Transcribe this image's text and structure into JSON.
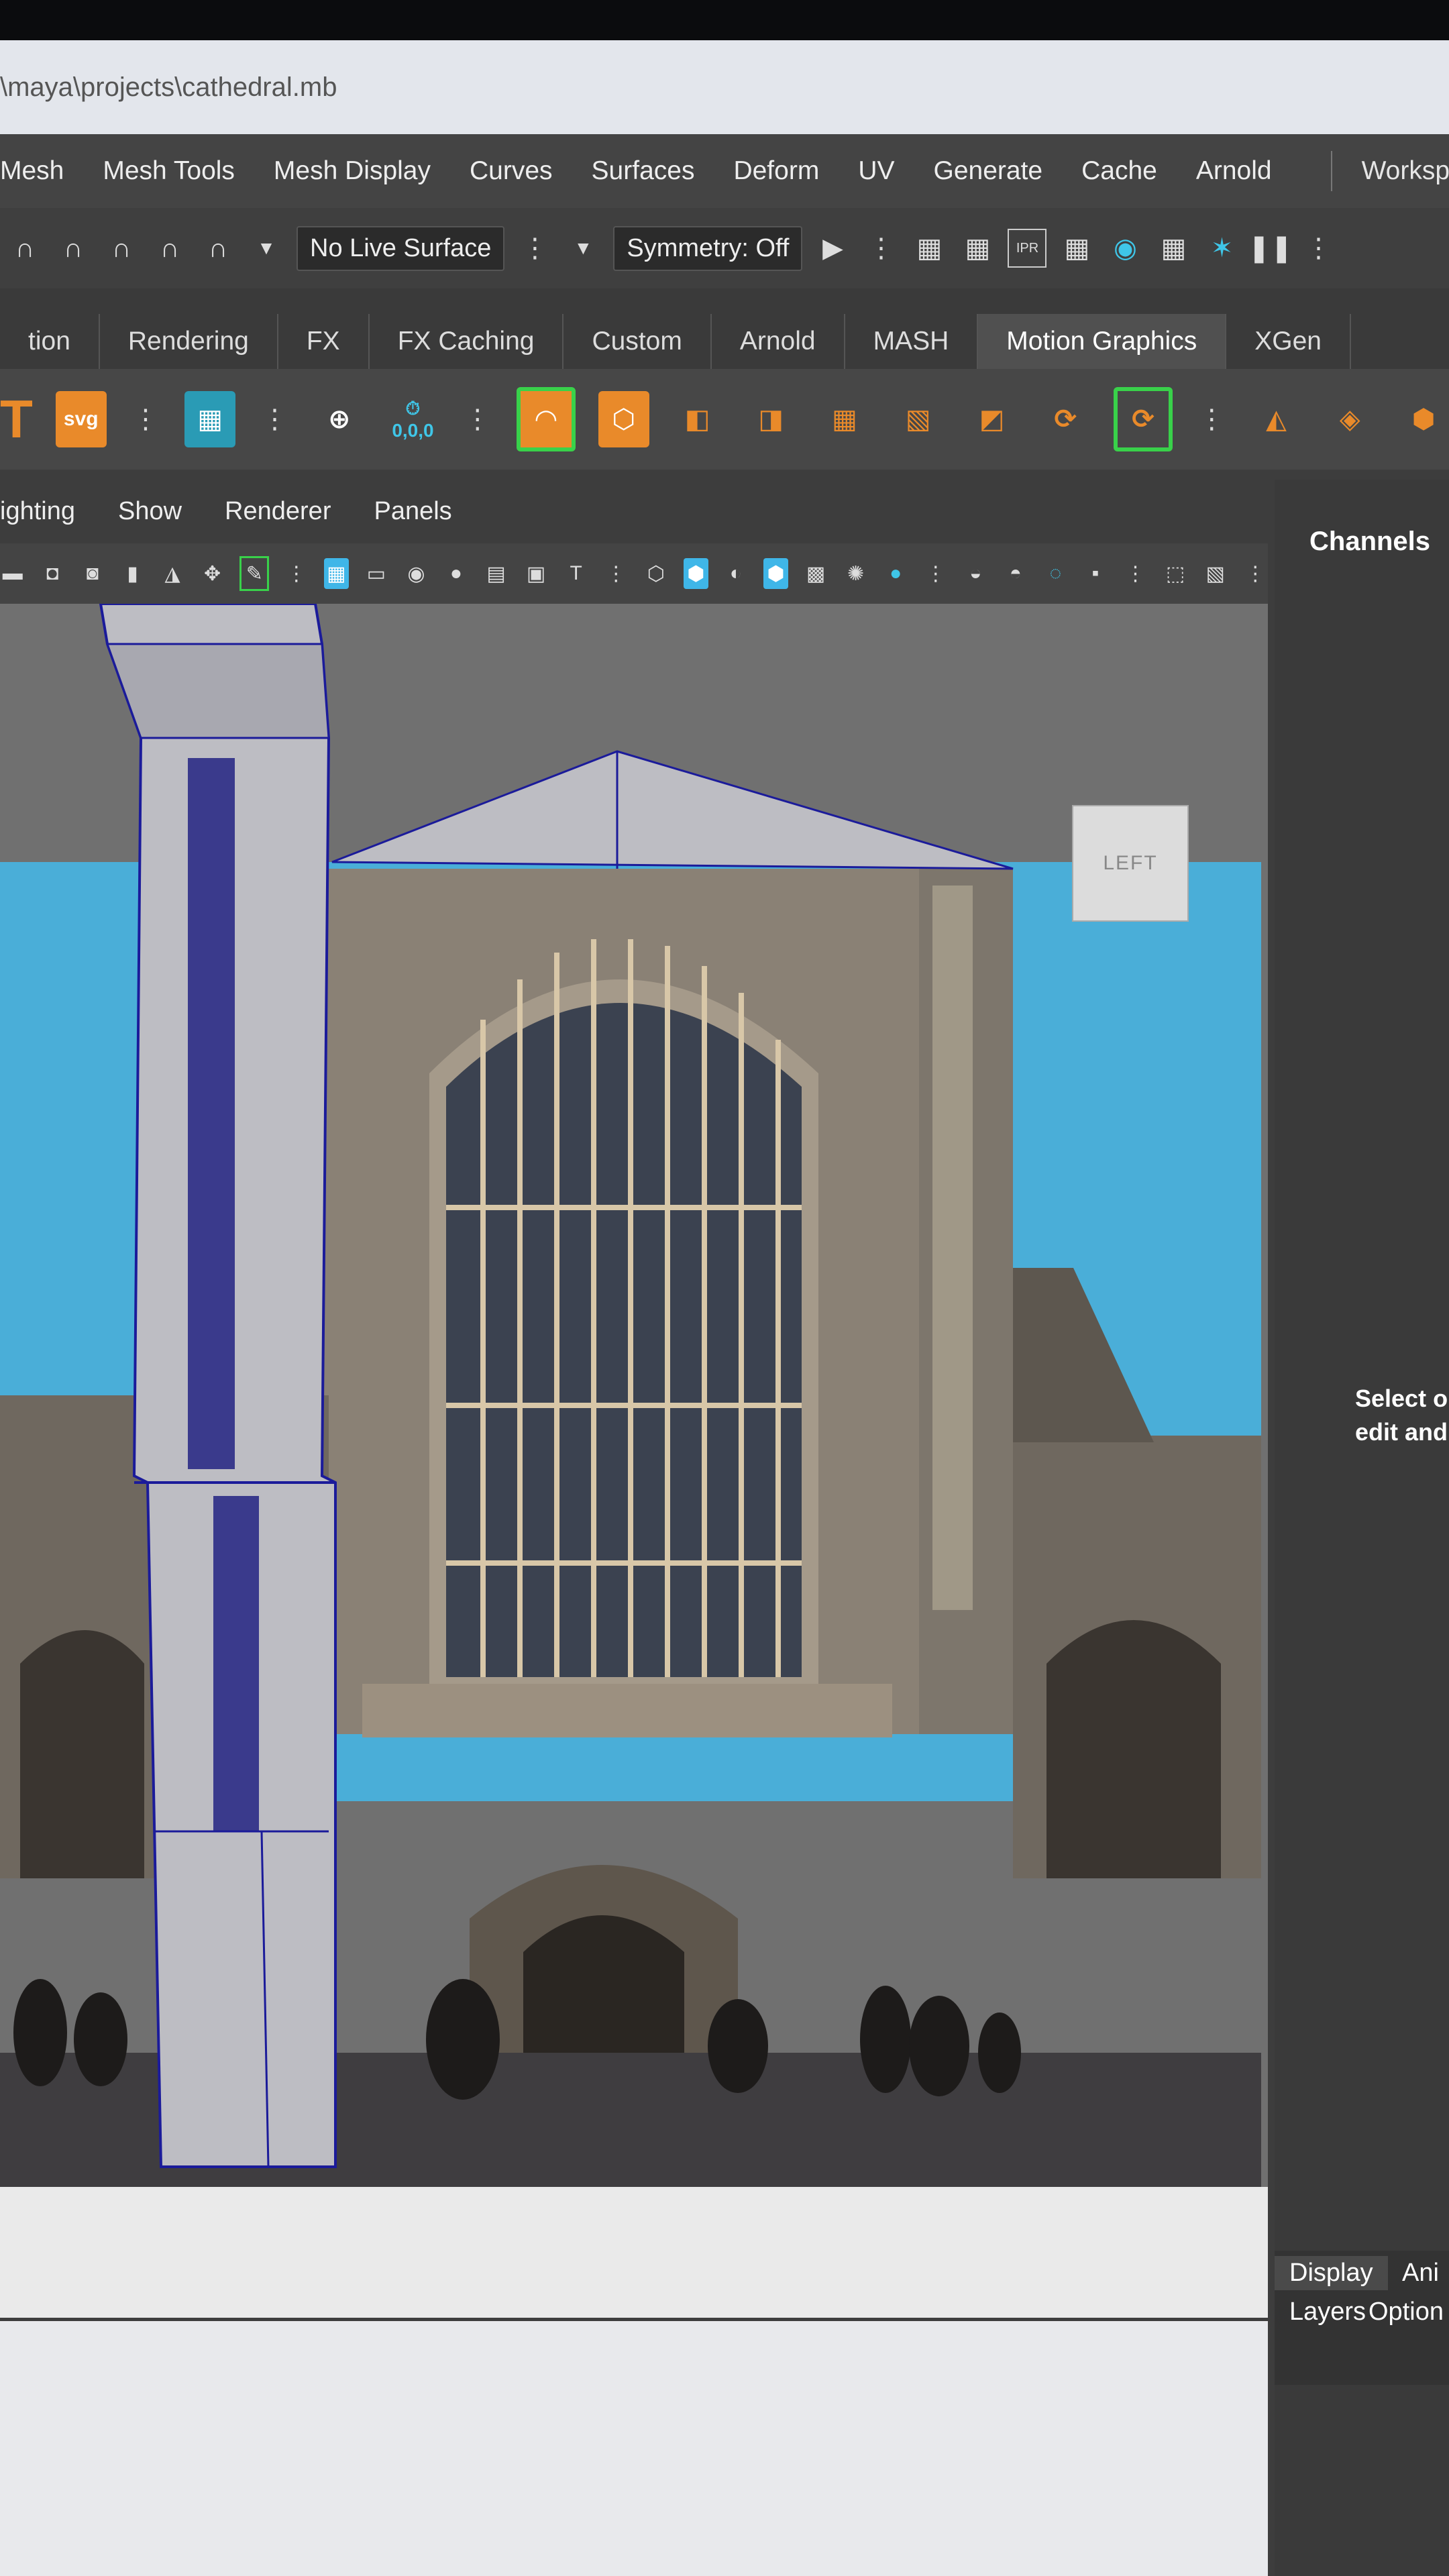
{
  "window": {
    "title_path": "\\maya\\projects\\cathedral.mb"
  },
  "menubar": {
    "items": [
      "Mesh",
      "Mesh Tools",
      "Mesh Display",
      "Curves",
      "Surfaces",
      "Deform",
      "UV",
      "Generate",
      "Cache",
      "Arnold"
    ],
    "workspace_label": "Workspace:"
  },
  "statusline": {
    "live_surface": "No Live Surface",
    "symmetry": "Symmetry: Off",
    "ipr_label": "IPR"
  },
  "shelf": {
    "tabs": [
      "tion",
      "Rendering",
      "FX",
      "FX Caching",
      "Custom",
      "Arnold",
      "MASH",
      "Motion Graphics",
      "XGen"
    ],
    "active_tab": "Motion Graphics",
    "text_tool": "T",
    "svg_tool": "svg",
    "origin_readout": "0,0,0"
  },
  "panel": {
    "menus": [
      "ighting",
      "Show",
      "Renderer",
      "Panels"
    ]
  },
  "viewport": {
    "view_cube_label": "LEFT",
    "sky_color": "#4aaed8"
  },
  "channel_box": {
    "title": "Channels",
    "hint_line1": "Select o",
    "hint_line2": "edit and",
    "display_tab": "Display",
    "anim_tab": "Ani",
    "layers_label": "Layers",
    "options_label": "Option"
  }
}
